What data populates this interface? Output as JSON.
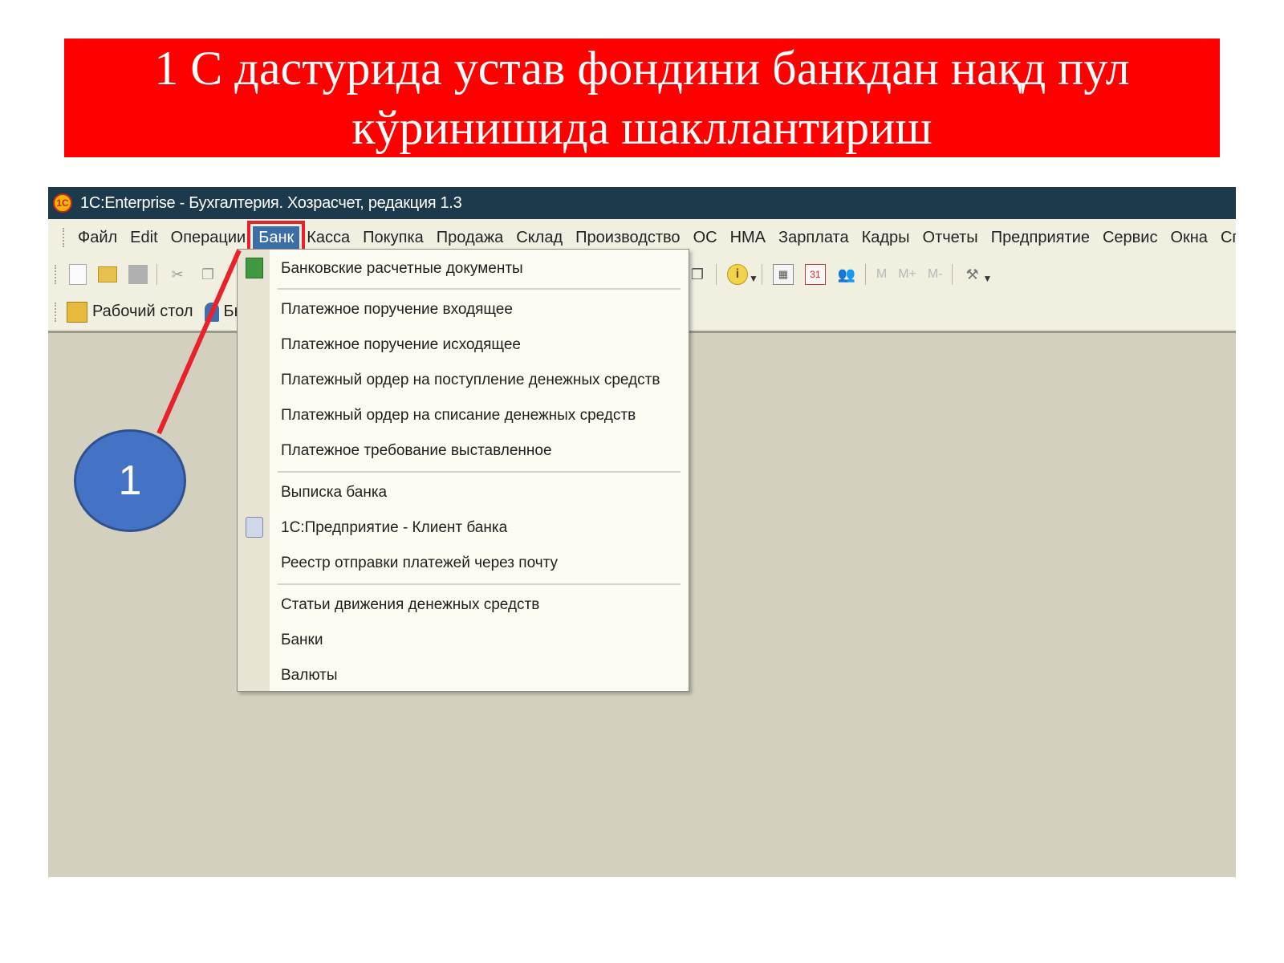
{
  "slide": {
    "title": "1 С дастурида устав фондини банкдан нақд пул кўринишида шакллантириш"
  },
  "window": {
    "title": "1С:Enterprise - Бухгалтерия. Хозрасчет, редакция 1.3",
    "logo_text": "1С"
  },
  "menubar": {
    "items": [
      "Файл",
      "Edit",
      "Операции",
      "Банк",
      "Касса",
      "Покупка",
      "Продажа",
      "Склад",
      "Производство",
      "ОС",
      "НМА",
      "Зарплата",
      "Кадры",
      "Отчеты",
      "Предприятие",
      "Сервис",
      "Окна",
      "Справка"
    ],
    "active": "Банк"
  },
  "toolbar": {
    "info_glyph": "i",
    "m_labels": [
      "M",
      "M+",
      "M-"
    ],
    "calendar_day": "31"
  },
  "toolbar2": {
    "desktop_label": "Рабочий стол",
    "quick_label": "Быс"
  },
  "dropdown": {
    "items": [
      "Банковские расчетные документы",
      "Платежное поручение входящее",
      "Платежное поручение исходящее",
      "Платежный ордер на поступление денежных средств",
      "Платежный ордер на списание денежных средств",
      "Платежное требование выставленное",
      "Выписка банка",
      "1С:Предприятие - Клиент банка",
      "Реестр отправки платежей через почту",
      "Статьи движения денежных средств",
      "Банки",
      "Валюты"
    ]
  },
  "annotation": {
    "number": "1",
    "color": "#4472c4",
    "line_color": "#e8222a"
  },
  "colors": {
    "banner": "#ff0000",
    "titlebar": "#1d3a4c",
    "menu_active": "#3a6ea5",
    "workspace": "#d4d0bf"
  }
}
